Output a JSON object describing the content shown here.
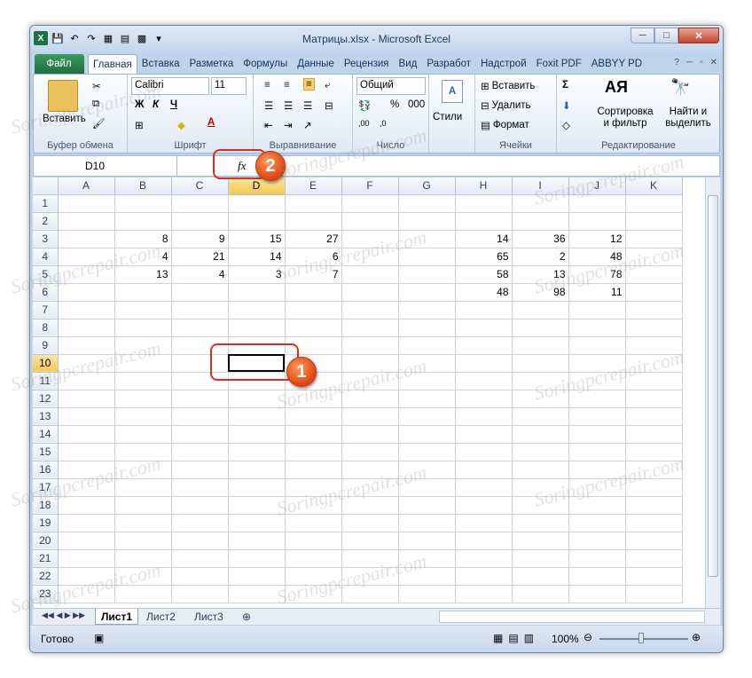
{
  "window": {
    "title": "Матрицы.xlsx - Microsoft Excel"
  },
  "tabs": [
    "Файл",
    "Главная",
    "Вставка",
    "Разметка",
    "Формулы",
    "Данные",
    "Рецензия",
    "Вид",
    "Разработ",
    "Надстрой",
    "Foxit PDF",
    "ABBYY PD"
  ],
  "ribbon": {
    "clipboard": {
      "paste": "Вставить",
      "label": "Буфер обмена"
    },
    "font": {
      "name": "Calibri",
      "size": "11",
      "bold": "Ж",
      "italic": "К",
      "underline": "Ч",
      "color_letter": "A",
      "label": "Шрифт"
    },
    "alignment": {
      "label": "Выравнивание"
    },
    "number": {
      "format": "Общий",
      "percent": "%",
      "label": "Число"
    },
    "styles": {
      "label": "Стили"
    },
    "cells": {
      "insert": "Вставить",
      "delete": "Удалить",
      "format": "Формат",
      "label": "Ячейки"
    },
    "editing": {
      "sort": "Сортировка и фильтр",
      "find": "Найти и выделить",
      "label": "Редактирование"
    }
  },
  "formula_bar": {
    "name_box": "D10",
    "fx": "fx",
    "value": ""
  },
  "columns": [
    "A",
    "B",
    "C",
    "D",
    "E",
    "F",
    "G",
    "H",
    "I",
    "J",
    "K"
  ],
  "rows": [
    [
      "",
      "",
      "",
      "",
      "",
      "",
      "",
      "",
      "",
      ""
    ],
    [
      "",
      "",
      "",
      "",
      "",
      "",
      "",
      "",
      "",
      ""
    ],
    [
      "",
      "8",
      "9",
      "15",
      "27",
      "",
      "",
      "14",
      "36",
      "12"
    ],
    [
      "",
      "4",
      "21",
      "14",
      "6",
      "",
      "",
      "65",
      "2",
      "48"
    ],
    [
      "",
      "13",
      "4",
      "3",
      "7",
      "",
      "",
      "58",
      "13",
      "78"
    ],
    [
      "",
      "",
      "",
      "",
      "",
      "",
      "",
      "48",
      "98",
      "11"
    ],
    [
      "",
      "",
      "",
      "",
      "",
      "",
      "",
      "",
      "",
      ""
    ],
    [
      "",
      "",
      "",
      "",
      "",
      "",
      "",
      "",
      "",
      ""
    ],
    [
      "",
      "",
      "",
      "",
      "",
      "",
      "",
      "",
      "",
      ""
    ],
    [
      "",
      "",
      "",
      "",
      "",
      "",
      "",
      "",
      "",
      ""
    ],
    [
      "",
      "",
      "",
      "",
      "",
      "",
      "",
      "",
      "",
      ""
    ],
    [
      "",
      "",
      "",
      "",
      "",
      "",
      "",
      "",
      "",
      ""
    ],
    [
      "",
      "",
      "",
      "",
      "",
      "",
      "",
      "",
      "",
      ""
    ],
    [
      "",
      "",
      "",
      "",
      "",
      "",
      "",
      "",
      "",
      ""
    ],
    [
      "",
      "",
      "",
      "",
      "",
      "",
      "",
      "",
      "",
      ""
    ],
    [
      "",
      "",
      "",
      "",
      "",
      "",
      "",
      "",
      "",
      ""
    ],
    [
      "",
      "",
      "",
      "",
      "",
      "",
      "",
      "",
      "",
      ""
    ],
    [
      "",
      "",
      "",
      "",
      "",
      "",
      "",
      "",
      "",
      ""
    ],
    [
      "",
      "",
      "",
      "",
      "",
      "",
      "",
      "",
      "",
      ""
    ],
    [
      "",
      "",
      "",
      "",
      "",
      "",
      "",
      "",
      "",
      ""
    ],
    [
      "",
      "",
      "",
      "",
      "",
      "",
      "",
      "",
      "",
      ""
    ],
    [
      "",
      "",
      "",
      "",
      "",
      "",
      "",
      "",
      "",
      ""
    ],
    [
      "",
      "",
      "",
      "",
      "",
      "",
      "",
      "",
      "",
      ""
    ]
  ],
  "active_cell": "D10",
  "sheets": [
    "Лист1",
    "Лист2",
    "Лист3"
  ],
  "status": {
    "ready": "Готово",
    "zoom": "100%"
  },
  "callouts": {
    "one": "1",
    "two": "2"
  },
  "watermark": "Soringpcrepair.com"
}
